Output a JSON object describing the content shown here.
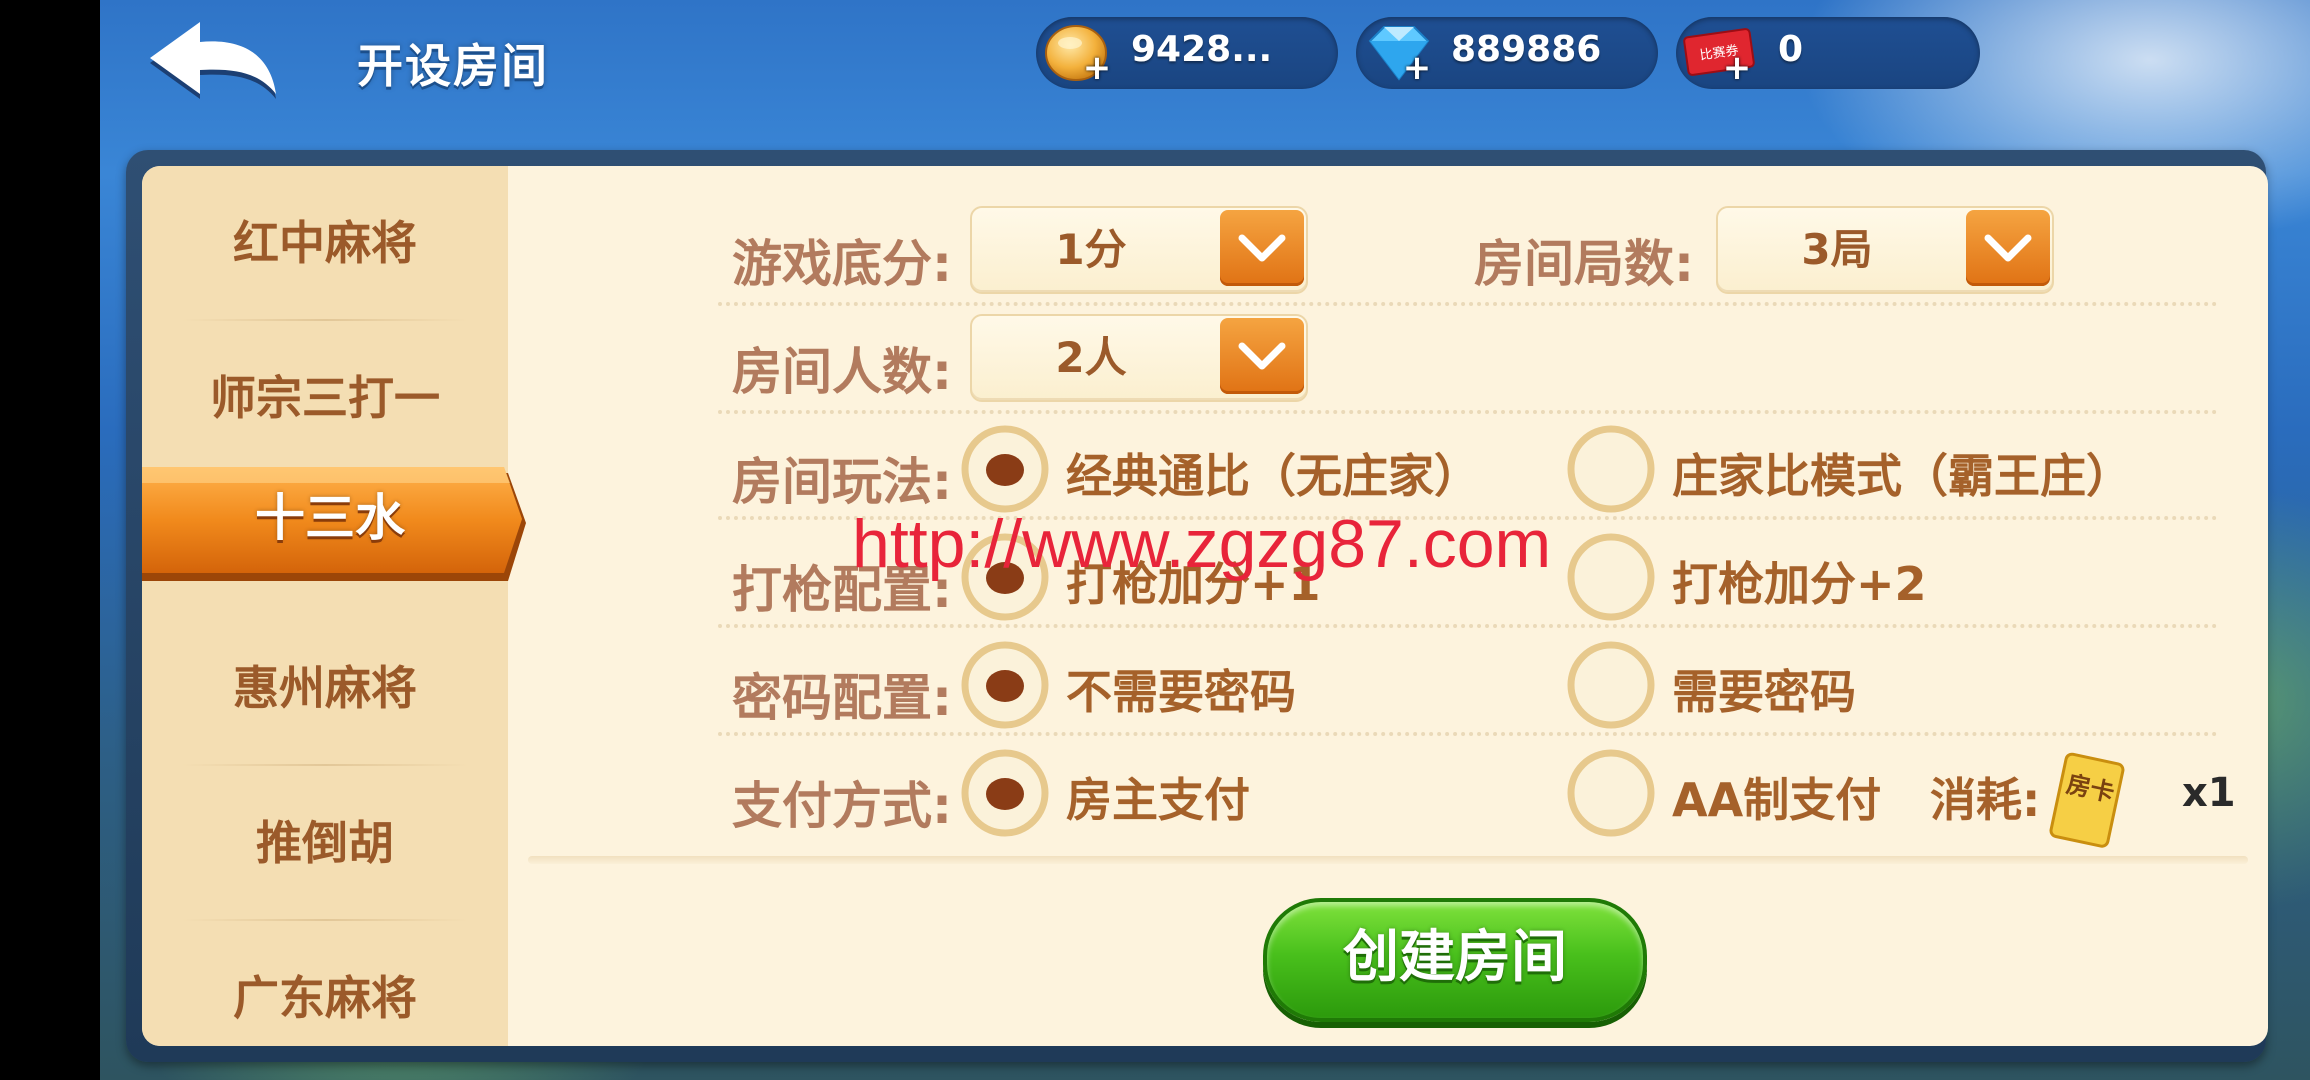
{
  "header": {
    "title": "开设房间",
    "gold": "9428...",
    "diamond": "889886",
    "ticket_label": "比赛券",
    "ticket": "0"
  },
  "sidebar": {
    "items": [
      "红中麻将",
      "师宗三打一",
      "十三水",
      "惠州麻将",
      "推倒胡",
      "广东麻将"
    ],
    "active": "十三水"
  },
  "settings": {
    "base_score_label": "游戏底分:",
    "base_score_value": "1分",
    "rounds_label": "房间局数:",
    "rounds_value": "3局",
    "players_label": "房间人数:",
    "players_value": "2人",
    "mode_label": "房间玩法:",
    "mode_opt1": "经典通比（无庄家）",
    "mode_opt2": "庄家比模式（霸王庄）",
    "gun_label": "打枪配置:",
    "gun_opt1": "打枪加分+1",
    "gun_opt2": "打枪加分+2",
    "password_label": "密码配置:",
    "password_opt1": "不需要密码",
    "password_opt2": "需要密码",
    "payment_label": "支付方式:",
    "payment_opt1": "房主支付",
    "payment_opt2": "AA制支付",
    "cost_label": "消耗:",
    "card_text": "房卡",
    "cost_count": "x1"
  },
  "create_button": "创建房间",
  "watermark": "http://www.zgzg87.com",
  "colors": {
    "accent_orange": "#e07214",
    "create_green": "#49c01c",
    "panel_bg": "#fdf3dd",
    "label_brown": "#b27b5e"
  }
}
